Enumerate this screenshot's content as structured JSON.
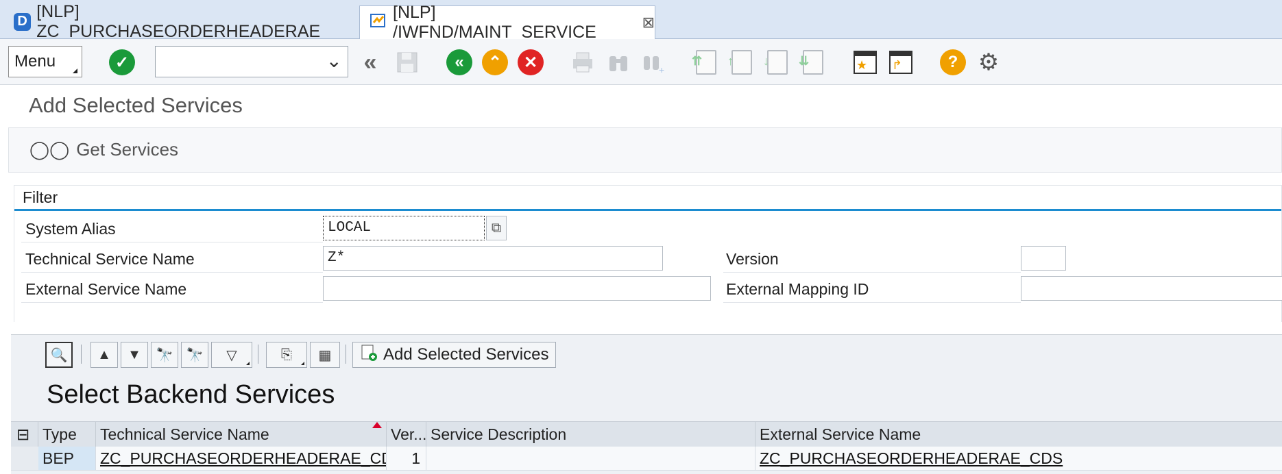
{
  "tabs": [
    {
      "badge": "D",
      "label": "[NLP] ZC_PURCHASEORDERHEADERAE"
    },
    {
      "label": "[NLP] /IWFND/MAINT_SERVICE",
      "close": "⊠"
    }
  ],
  "toolbar": {
    "menu_label": "Menu",
    "command_field_value": "",
    "icons": [
      "enter-icon",
      "back-double-icon",
      "save-icon",
      "back-icon",
      "exit-icon",
      "cancel-icon",
      "print-icon",
      "find-icon",
      "find-next-icon",
      "first-page-icon",
      "previous-page-icon",
      "next-page-icon",
      "last-page-icon",
      "create-session-icon",
      "shortcut-icon",
      "help-icon",
      "customize-layout-icon"
    ]
  },
  "page": {
    "title": "Add Selected Services",
    "get_services_label": "Get Services"
  },
  "filter": {
    "header": "Filter",
    "system_alias_label": "System Alias",
    "system_alias_value": "LOCAL",
    "technical_service_name_label": "Technical Service Name",
    "technical_service_name_value": "Z*",
    "version_label": "Version",
    "version_value": "",
    "external_service_name_label": "External Service Name",
    "external_service_name_value": "",
    "external_mapping_id_label": "External Mapping ID",
    "external_mapping_id_value": ""
  },
  "alv": {
    "add_selected_label": "Add Selected Services",
    "grid_title": "Select Backend Services",
    "columns": [
      "Type",
      "Technical Service Name",
      "Ver...",
      "Service Description",
      "External Service Name"
    ],
    "rows": [
      {
        "type": "BEP",
        "technical_service_name": "ZC_PURCHASEORDERHEADERAE_CDS",
        "version": "1",
        "service_description": "",
        "external_service_name": "ZC_PURCHASEORDERHEADERAE_CDS"
      }
    ]
  },
  "colors": {
    "accent_blue": "#1c8cd0",
    "enter_green": "#1a9a3a",
    "cancel_red": "#e02424",
    "help_orange": "#f0a000"
  }
}
